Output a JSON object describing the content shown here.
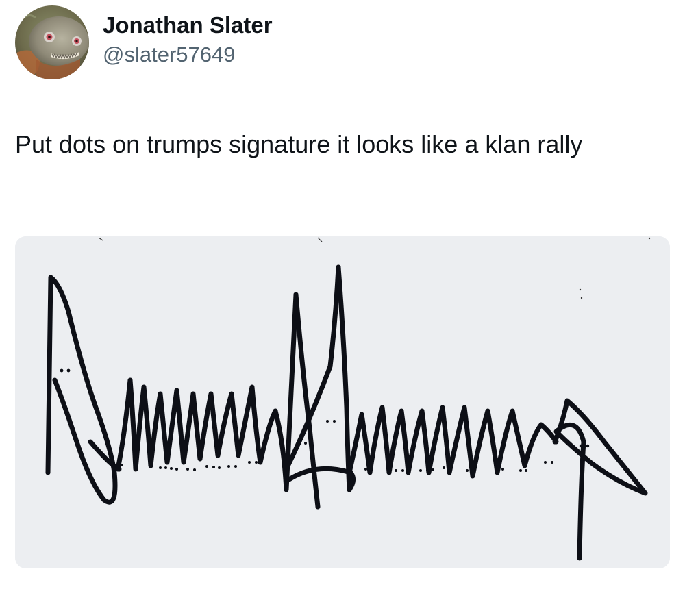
{
  "author": {
    "display_name": "Jonathan Slater",
    "handle": "@slater57649",
    "avatar_icon": "piranha-avatar-icon"
  },
  "tweet": {
    "text": "Put dots on trumps signature it looks like a klan rally"
  },
  "media": {
    "description_icon": "signature-image",
    "signature_text": "Donald Trump"
  },
  "colors": {
    "text_primary": "#0f1419",
    "text_secondary": "#536471",
    "media_background": "#eceef1",
    "ink": "#0d0f16"
  }
}
